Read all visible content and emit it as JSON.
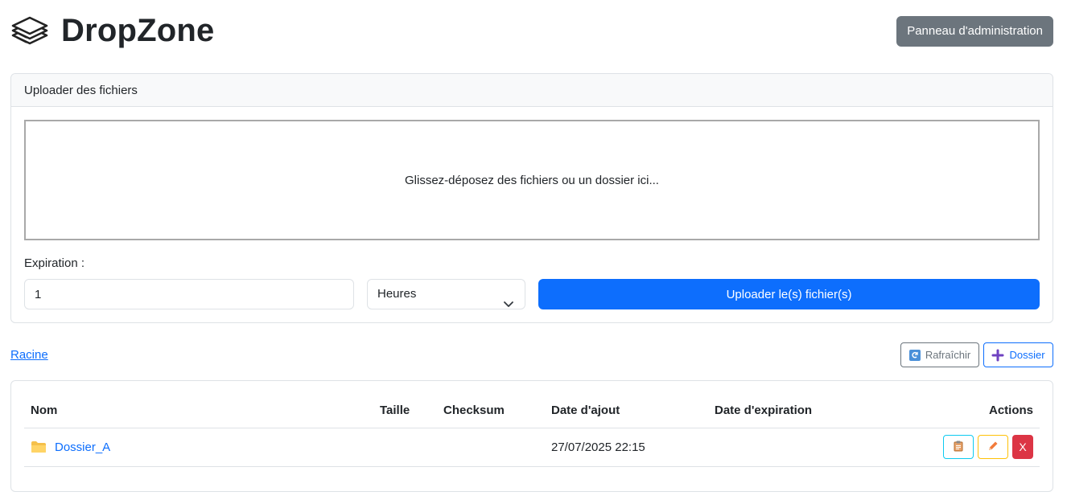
{
  "app": {
    "title": "DropZone",
    "icon": "stack-of-papers-icon"
  },
  "header": {
    "admin_button": "Panneau d'administration"
  },
  "upload": {
    "card_title": "Uploader des fichiers",
    "dropzone_text": "Glissez-déposez des fichiers ou un dossier ici...",
    "expiration_label": "Expiration :",
    "expiration_value": "1",
    "unit_selected": "Heures",
    "upload_button": "Uploader le(s) fichier(s)"
  },
  "toolbar": {
    "breadcrumb_root": "Racine",
    "refresh_label": "Rafraîchir",
    "refresh_icon": "refresh-icon",
    "new_folder_label": "Dossier",
    "new_folder_icon": "plus-icon"
  },
  "table": {
    "columns": [
      "Nom",
      "Taille",
      "Checksum",
      "Date d'ajout",
      "Date d'expiration",
      "Actions"
    ],
    "rows": [
      {
        "name": "Dossier_A",
        "icon": "folder-icon",
        "size": "",
        "checksum": "",
        "added": "27/07/2025 22:15",
        "expires": "",
        "actions": {
          "info_icon": "clipboard-icon",
          "edit_icon": "pencil-icon",
          "delete_label": "X"
        }
      }
    ]
  },
  "colors": {
    "primary": "#0d6efd",
    "secondary": "#6c757d",
    "danger": "#dc3545",
    "warning": "#ffc107",
    "info": "#0dcaf0",
    "folder": "#f5c04a"
  }
}
